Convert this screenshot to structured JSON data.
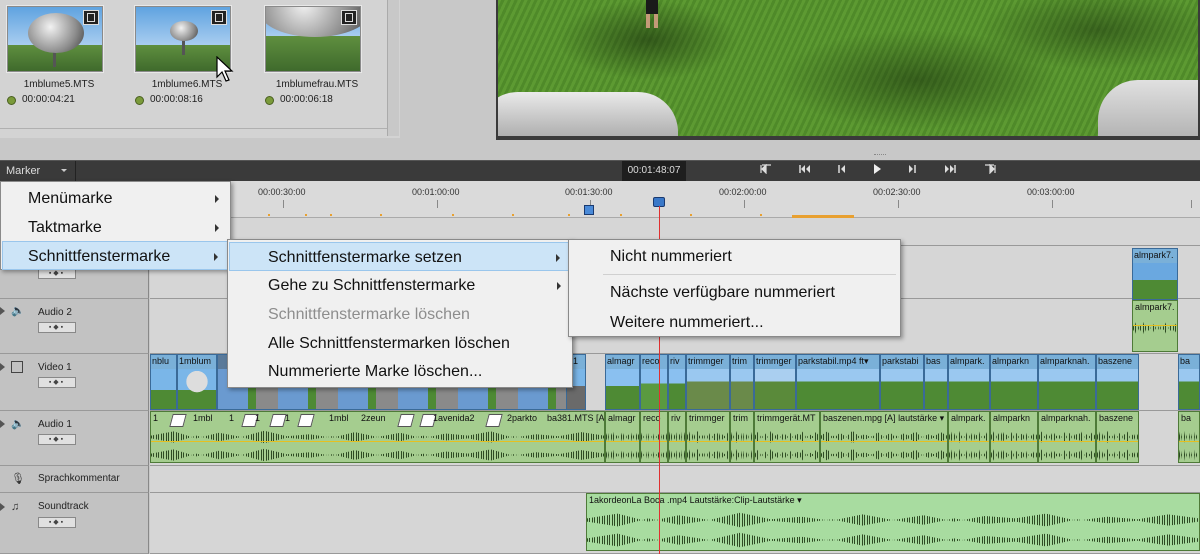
{
  "media_bin": {
    "clips": [
      {
        "name": "1mblume5.MTS",
        "duration": "00:00:04:21"
      },
      {
        "name": "1mblume6.MTS",
        "duration": "00:00:08:16"
      },
      {
        "name": "1mblumefrau.MTS",
        "duration": "00:00:06:18"
      }
    ]
  },
  "toolbar": {
    "marker_label": "Marker",
    "timecode": "00:01:48:07",
    "transport": [
      "◂|",
      "|◂◂",
      "◂|",
      "▶",
      "|▸",
      "▸▸|",
      "|▸"
    ]
  },
  "ruler": {
    "labels": [
      "00:00:30:00",
      "00:01:00:00",
      "00:01:30:00",
      "00:02:00:00",
      "00:02:30:00",
      "00:03:00:00"
    ]
  },
  "tracks": {
    "audio2": "Audio 2",
    "video1": "Video 1",
    "audio1": "Audio 1",
    "voiceover": "Sprachkommentar",
    "soundtrack": "Soundtrack",
    "controls": "▪◆▪"
  },
  "video_clips": [
    "nblu",
    "1mblum",
    "almagr",
    "reco",
    "riv",
    "trimmger",
    "trim",
    "trimmger",
    "parkstabil.mp4",
    "ft▾",
    "parkstabi",
    "bas",
    "almpark.",
    "almparkn",
    "almparknah.",
    "baszene",
    "ba"
  ],
  "video1_partial_label": "31",
  "top_right_clip": "almpark7.",
  "audio1_clips": [
    "1",
    "1mbl",
    "1",
    "1",
    "1",
    "1mbl",
    "2zeun",
    "1avenida2",
    "2parkto",
    "ba381.MTS [A]",
    "almagr",
    "reco",
    "riv",
    "trimmger",
    "trim",
    "trimmgerät.MT",
    "baszenen.mpg [A]",
    "lautstärke ▾",
    "almpark.",
    "almparkn",
    "almparknah.",
    "baszene",
    "ba"
  ],
  "soundtrack_clip": "1akordeonLa Boca .mp4 Lautstärke:Clip-Lautstärke ▾",
  "menus": {
    "marker_menu": [
      "Menümarke",
      "Taktmarke",
      "Schnittfenstermarke"
    ],
    "schnitt_menu": [
      "Schnittfenstermarke setzen",
      "Gehe zu Schnittfenstermarke",
      "Schnittfenstermarke löschen",
      "Alle Schnittfenstermarken löschen",
      "Nummerierte Marke löschen..."
    ],
    "setzen_menu": [
      "Nicht nummeriert",
      "Nächste verfügbare nummeriert",
      "Weitere nummeriert..."
    ]
  }
}
